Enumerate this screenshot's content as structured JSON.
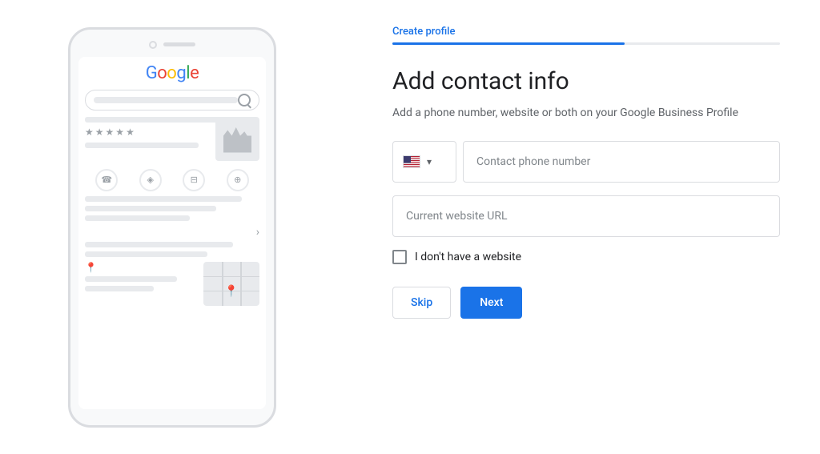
{
  "left": {
    "google_logo": {
      "g": "G",
      "o1": "o",
      "o2": "o",
      "g2": "g",
      "l": "l",
      "e": "e"
    }
  },
  "progress": {
    "label": "Create profile",
    "fill_percent": "60%"
  },
  "form": {
    "title": "Add contact info",
    "subtitle": "Add a phone number, website or both on your Google Business Profile",
    "phone_placeholder": "Contact phone number",
    "website_placeholder": "Current website URL",
    "checkbox_label": "I don't have a website",
    "skip_label": "Skip",
    "next_label": "Next"
  }
}
